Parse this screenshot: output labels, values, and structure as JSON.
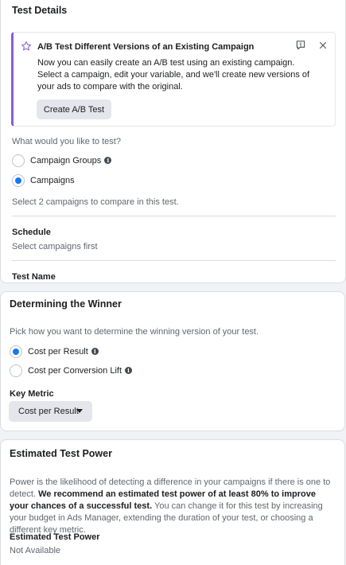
{
  "test_details": {
    "title": "Test Details",
    "callout": {
      "title": "A/B Test Different Versions of an Existing Campaign",
      "text": "Now you can easily create an A/B test using an existing campaign. Select a campaign, edit your variable, and we'll create new versions of your ads to compare with the original.",
      "button_label": "Create A/B Test"
    },
    "question": "What would you like to test?",
    "options": [
      {
        "label": "Campaign Groups",
        "selected": false,
        "info": true
      },
      {
        "label": "Campaigns",
        "selected": true,
        "info": false
      }
    ],
    "hint": "Select 2 campaigns to compare in this test.",
    "schedule": {
      "label": "Schedule",
      "value": "Select campaigns first"
    },
    "test_name_label": "Test Name"
  },
  "winner": {
    "title": "Determining the Winner",
    "description": "Pick how you want to determine the winning version of your test.",
    "options": [
      {
        "label": "Cost per Result",
        "selected": true
      },
      {
        "label": "Cost per Conversion Lift",
        "selected": false
      }
    ],
    "key_metric_label": "Key Metric",
    "key_metric_value": "Cost per Result"
  },
  "power": {
    "title": "Estimated Test Power",
    "text_normal_1": "Power is the likelihood of detecting a difference in your campaigns if there is one to detect.",
    "text_bold": "We recommend an estimated test power of at least 80% to improve your chances of a successful test.",
    "text_normal_2": "You can change it for this test by increasing your budget in Ads Manager, extending the duration of your test, or choosing a different key metric.",
    "result_label": "Estimated Test Power",
    "result_value": "Not Available"
  },
  "colors": {
    "accent": "#1877f2",
    "callout_border": "#8b5cd6",
    "muted_text": "#606770"
  },
  "icons": [
    "star-icon",
    "feedback-icon",
    "close-icon",
    "info-icon",
    "caret-down-icon"
  ]
}
